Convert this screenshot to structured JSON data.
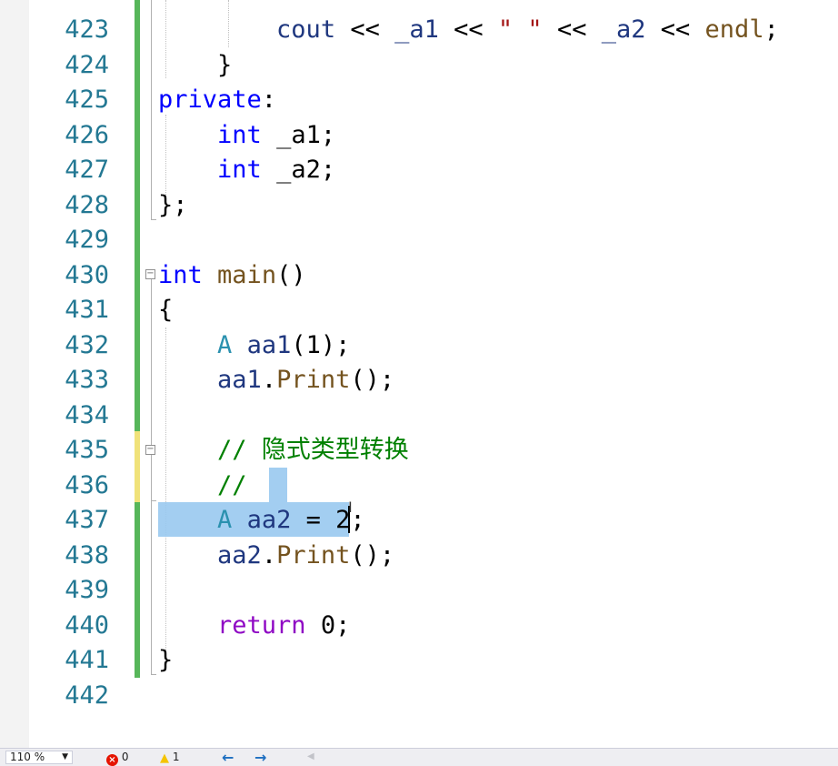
{
  "editor": {
    "lines": [
      {
        "n": "423",
        "tokens": [
          {
            "t": "        "
          },
          {
            "t": "cout",
            "c": "var"
          },
          {
            "t": " << "
          },
          {
            "t": "_a1",
            "c": "var"
          },
          {
            "t": " << "
          },
          {
            "t": "\" \"",
            "c": "str"
          },
          {
            "t": " << "
          },
          {
            "t": "_a2",
            "c": "var"
          },
          {
            "t": " << "
          },
          {
            "t": "endl",
            "c": "fn"
          },
          {
            "t": ";"
          }
        ]
      },
      {
        "n": "424",
        "tokens": [
          {
            "t": "    }"
          }
        ]
      },
      {
        "n": "425",
        "tokens": [
          {
            "t": "private",
            "c": "kw"
          },
          {
            "t": ":"
          }
        ]
      },
      {
        "n": "426",
        "tokens": [
          {
            "t": "    "
          },
          {
            "t": "int",
            "c": "kw"
          },
          {
            "t": " _a1;"
          }
        ]
      },
      {
        "n": "427",
        "tokens": [
          {
            "t": "    "
          },
          {
            "t": "int",
            "c": "kw"
          },
          {
            "t": " _a2;"
          }
        ]
      },
      {
        "n": "428",
        "tokens": [
          {
            "t": "};"
          }
        ]
      },
      {
        "n": "429",
        "tokens": []
      },
      {
        "n": "430",
        "tokens": [
          {
            "t": "int",
            "c": "kw"
          },
          {
            "t": " "
          },
          {
            "t": "main",
            "c": "fn"
          },
          {
            "t": "()"
          }
        ]
      },
      {
        "n": "431",
        "tokens": [
          {
            "t": "{"
          }
        ]
      },
      {
        "n": "432",
        "tokens": [
          {
            "t": "    "
          },
          {
            "t": "A",
            "c": "ty"
          },
          {
            "t": " "
          },
          {
            "t": "aa1",
            "c": "var"
          },
          {
            "t": "(1);"
          }
        ]
      },
      {
        "n": "433",
        "tokens": [
          {
            "t": "    "
          },
          {
            "t": "aa1",
            "c": "var"
          },
          {
            "t": "."
          },
          {
            "t": "Print",
            "c": "fn"
          },
          {
            "t": "();"
          }
        ]
      },
      {
        "n": "434",
        "tokens": []
      },
      {
        "n": "435",
        "tokens": [
          {
            "t": "    "
          },
          {
            "t": "// 隐式类型转换",
            "c": "cm"
          }
        ]
      },
      {
        "n": "436",
        "tokens": [
          {
            "t": "    "
          },
          {
            "t": "//",
            "c": "cm"
          }
        ]
      },
      {
        "n": "437",
        "tokens": [
          {
            "t": "    "
          },
          {
            "t": "A",
            "c": "ty"
          },
          {
            "t": " "
          },
          {
            "t": "aa2",
            "c": "var"
          },
          {
            "t": " = 2;"
          }
        ]
      },
      {
        "n": "438",
        "tokens": [
          {
            "t": "    "
          },
          {
            "t": "aa2",
            "c": "var"
          },
          {
            "t": "."
          },
          {
            "t": "Print",
            "c": "fn"
          },
          {
            "t": "();"
          }
        ]
      },
      {
        "n": "439",
        "tokens": []
      },
      {
        "n": "440",
        "tokens": [
          {
            "t": "    "
          },
          {
            "t": "return",
            "c": "ctrl"
          },
          {
            "t": " 0;"
          }
        ]
      },
      {
        "n": "441",
        "tokens": [
          {
            "t": "}"
          }
        ]
      },
      {
        "n": "442",
        "tokens": []
      }
    ]
  },
  "statusbar": {
    "zoom": "110 %",
    "errors": "0",
    "warnings": "1",
    "nav_back": "←",
    "nav_forward": "→"
  },
  "colors": {
    "keyword": "#0000ff",
    "type": "#2b91af",
    "function": "#74531f",
    "variable": "#1f377f",
    "string": "#a31515",
    "comment": "#008000",
    "control": "#8f08c4",
    "line_number": "#237893",
    "selection": "#99c9ef",
    "change_saved": "#57b65a",
    "change_unsaved": "#f0e27a"
  }
}
